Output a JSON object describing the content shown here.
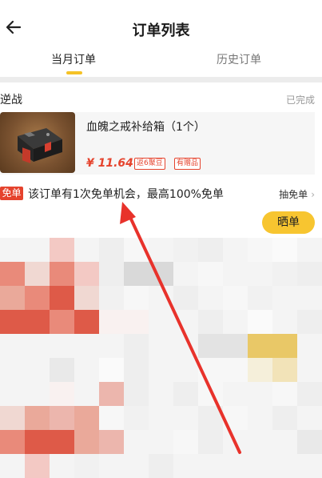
{
  "header": {
    "title": "订单列表",
    "back_icon": "back-arrow-icon"
  },
  "tabs": [
    {
      "label": "当月订单",
      "active": true
    },
    {
      "label": "历史订单",
      "active": false
    }
  ],
  "order": {
    "shop_name": "逆战",
    "status": "已完成",
    "product": {
      "title": "血魄之戒补给箱（1个）",
      "price": "¥ 11.64",
      "tags": [
        "返6聚豆",
        "有赠品"
      ],
      "image_icon": "supply-crate-image"
    },
    "free_order": {
      "badge": "免单",
      "text": "该订单有1次免单机会，最高100%免单",
      "link_label": "抽免单"
    },
    "share_button_label": "晒单"
  },
  "colors": {
    "accent_yellow": "#f7c530",
    "price_red": "#e5432d",
    "annotation_red": "#e8322b"
  }
}
